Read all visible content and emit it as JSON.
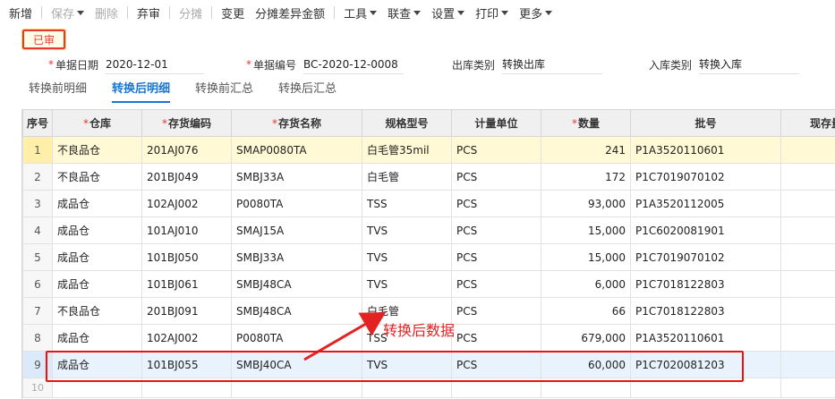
{
  "toolbar": {
    "items": [
      {
        "label": "新增",
        "disabled": false,
        "dropdown": false
      },
      {
        "label": "保存",
        "disabled": true,
        "dropdown": true
      },
      {
        "label": "删除",
        "disabled": true,
        "dropdown": false
      },
      {
        "label": "弃审",
        "disabled": false,
        "dropdown": false
      },
      {
        "label": "分摊",
        "disabled": true,
        "dropdown": false
      },
      {
        "label": "变更",
        "disabled": false,
        "dropdown": false
      },
      {
        "label": "分摊差异金额",
        "disabled": false,
        "dropdown": false
      },
      {
        "label": "工具",
        "disabled": false,
        "dropdown": true
      },
      {
        "label": "联查",
        "disabled": false,
        "dropdown": true
      },
      {
        "label": "设置",
        "disabled": false,
        "dropdown": true
      },
      {
        "label": "打印",
        "disabled": false,
        "dropdown": true
      },
      {
        "label": "更多",
        "disabled": false,
        "dropdown": true
      }
    ]
  },
  "status": "已审",
  "form": {
    "date_label": "单据日期",
    "date_value": "2020-12-01",
    "docno_label": "单据编号",
    "docno_value": "BC-2020-12-0008",
    "out_type_label": "出库类别",
    "out_type_value": "转换出库",
    "in_type_label": "入库类别",
    "in_type_value": "转换入库"
  },
  "tabs": [
    "转换前明细",
    "转换后明细",
    "转换前汇总",
    "转换后汇总"
  ],
  "active_tab": 1,
  "table": {
    "columns": [
      {
        "label": "序号",
        "required": false
      },
      {
        "label": "仓库",
        "required": true
      },
      {
        "label": "存货编码",
        "required": true
      },
      {
        "label": "存货名称",
        "required": true
      },
      {
        "label": "规格型号",
        "required": false
      },
      {
        "label": "计量单位",
        "required": false
      },
      {
        "label": "数量",
        "required": true
      },
      {
        "label": "批号",
        "required": false
      },
      {
        "label": "现存量说",
        "required": false
      }
    ],
    "rows": [
      {
        "idx": "1",
        "wh": "不良品仓",
        "code": "201AJ076",
        "name": "SMAP0080TA",
        "spec": "白毛管35mil",
        "unit": "PCS",
        "qty": "241",
        "batch": "P1A3520110601"
      },
      {
        "idx": "2",
        "wh": "不良品仓",
        "code": "201BJ049",
        "name": "SMBJ33A",
        "spec": "白毛管",
        "unit": "PCS",
        "qty": "172",
        "batch": "P1C7019070102"
      },
      {
        "idx": "3",
        "wh": "成品仓",
        "code": "102AJ002",
        "name": "P0080TA",
        "spec": "TSS",
        "unit": "PCS",
        "qty": "93,000",
        "batch": "P1A3520112005"
      },
      {
        "idx": "4",
        "wh": "成品仓",
        "code": "101AJ010",
        "name": "SMAJ15A",
        "spec": "TVS",
        "unit": "PCS",
        "qty": "15,000",
        "batch": "P1C6020081901"
      },
      {
        "idx": "5",
        "wh": "成品仓",
        "code": "101BJ050",
        "name": "SMBJ33A",
        "spec": "TVS",
        "unit": "PCS",
        "qty": "15,000",
        "batch": "P1C7019070102"
      },
      {
        "idx": "6",
        "wh": "成品仓",
        "code": "101BJ061",
        "name": "SMBJ48CA",
        "spec": "TVS",
        "unit": "PCS",
        "qty": "6,000",
        "batch": "P1C7018122803"
      },
      {
        "idx": "7",
        "wh": "不良品仓",
        "code": "201BJ091",
        "name": "SMBJ48CA",
        "spec": "白毛管",
        "unit": "PCS",
        "qty": "66",
        "batch": "P1C7018122803"
      },
      {
        "idx": "8",
        "wh": "成品仓",
        "code": "102AJ002",
        "name": "P0080TA",
        "spec": "TSS",
        "unit": "PCS",
        "qty": "679,000",
        "batch": "P1A3520110601"
      },
      {
        "idx": "9",
        "wh": "成品仓",
        "code": "101BJ055",
        "name": "SMBJ40CA",
        "spec": "TVS",
        "unit": "PCS",
        "qty": "60,000",
        "batch": "P1C7020081203"
      }
    ],
    "empty_row_idx": "10",
    "selected_row": 1,
    "highlighted_row": 9
  },
  "annotation": {
    "text": "转换后数据",
    "color": "#e32222"
  },
  "colors": {
    "accent": "#1976d2",
    "required": "#e53935",
    "selected_row_bg": "#fff9d6",
    "highlight_row_bg": "#e9f3fd"
  }
}
